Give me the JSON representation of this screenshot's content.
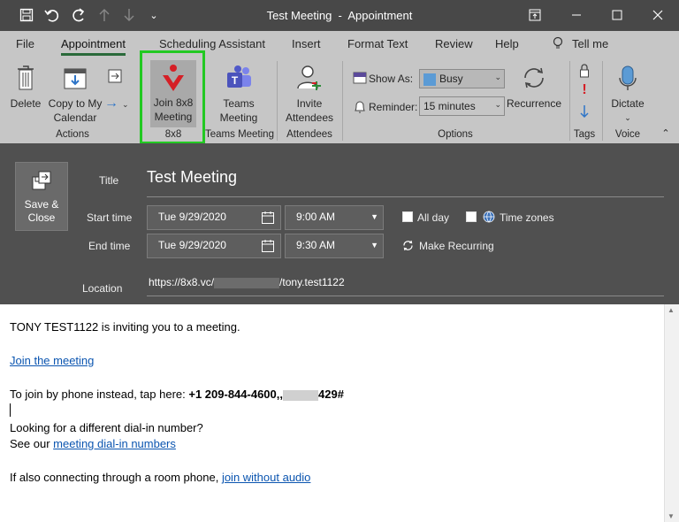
{
  "window": {
    "title": "Test Meeting",
    "separator": "-",
    "app_title": "Appointment"
  },
  "qat": {
    "save_icon": "save-icon",
    "undo_icon": "undo-icon",
    "redo_icon": "redo-icon",
    "up_icon": "arrow-up-icon",
    "down_icon": "arrow-down-icon",
    "more_icon": "chevron-down-icon"
  },
  "tabs": [
    {
      "label": "File"
    },
    {
      "label": "Appointment"
    },
    {
      "label": "Scheduling Assistant"
    },
    {
      "label": "Insert"
    },
    {
      "label": "Format Text"
    },
    {
      "label": "Review"
    },
    {
      "label": "Help"
    }
  ],
  "tell_me": "Tell me",
  "ribbon": {
    "delete_label": "Delete",
    "copy_label_1": "Copy to My",
    "copy_label_2": "Calendar",
    "actions_group": "Actions",
    "join_label_1": "Join 8x8",
    "join_label_2": "Meeting",
    "eightbyeight_group": "8x8",
    "teams_label_1": "Teams",
    "teams_label_2": "Meeting",
    "teams_group": "Teams Meeting",
    "invite_label_1": "Invite",
    "invite_label_2": "Attendees",
    "attendees_group": "Attendees",
    "show_as_label": "Show As:",
    "show_as_value": "Busy",
    "reminder_label": "Reminder:",
    "reminder_value": "15 minutes",
    "recurrence_label": "Recurrence",
    "options_group": "Options",
    "tags_group": "Tags",
    "dictate_label": "Dictate",
    "voice_group": "Voice",
    "busy_color": "#5b9bd5",
    "highlight_color": "#22c922"
  },
  "form": {
    "save_close_1": "Save &",
    "save_close_2": "Close",
    "title_label": "Title",
    "title_value": "Test Meeting",
    "start_label": "Start time",
    "start_date": "Tue 9/29/2020",
    "start_time": "9:00 AM",
    "all_day": "All day",
    "time_zones": "Time zones",
    "end_label": "End time",
    "end_date": "Tue 9/29/2020",
    "end_time": "9:30 AM",
    "make_recurring": "Make Recurring",
    "location_label": "Location",
    "location_prefix": "https://8x8.vc/",
    "location_suffix": "/tony.test1122"
  },
  "body": {
    "invite_line": "TONY TEST1122 is inviting you to a meeting.",
    "join_link": "Join the meeting",
    "phone_prefix": "To join by phone instead, tap here: ",
    "phone_number": "+1 209-844-4600,,",
    "phone_suffix": "429#",
    "dialin_question": "Looking for a different dial-in number?",
    "see_our": "See our ",
    "dialin_link": "meeting dial-in numbers",
    "room_prefix": "If also connecting through a room phone, ",
    "room_link": "join without audio"
  }
}
